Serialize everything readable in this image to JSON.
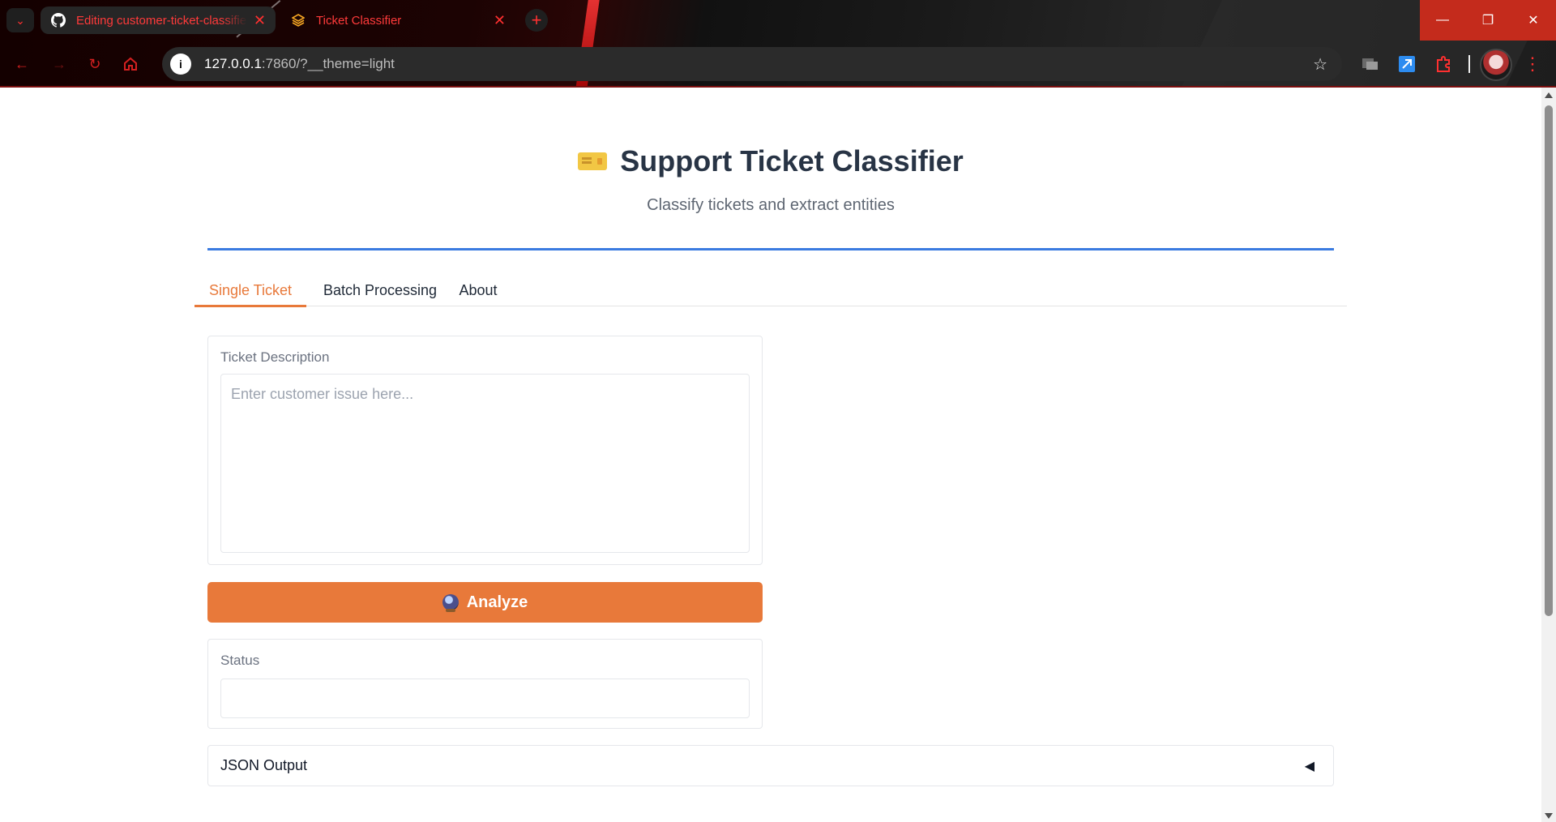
{
  "browser": {
    "tabs": [
      {
        "label": "Editing customer-ticket-classifier",
        "icon": "github-icon"
      },
      {
        "label": "Ticket Classifier",
        "icon": "layers-icon"
      }
    ],
    "url_host": "127.0.0.1",
    "url_rest": ":7860/?__theme=light"
  },
  "page": {
    "title": "Support Ticket Classifier",
    "subtitle": "Classify tickets and extract entities",
    "tabs": [
      "Single Ticket",
      "Batch Processing",
      "About"
    ],
    "active_tab": "Single Ticket",
    "description": {
      "label": "Ticket Description",
      "placeholder": "Enter customer issue here...",
      "value": ""
    },
    "analyze_label": "Analyze",
    "status": {
      "label": "Status",
      "value": ""
    },
    "json_output": {
      "label": "JSON Output",
      "arrow": "◀"
    }
  },
  "colors": {
    "accent": "#e8793a",
    "rule": "#3b7be0",
    "browser_accent": "#ff3030"
  }
}
